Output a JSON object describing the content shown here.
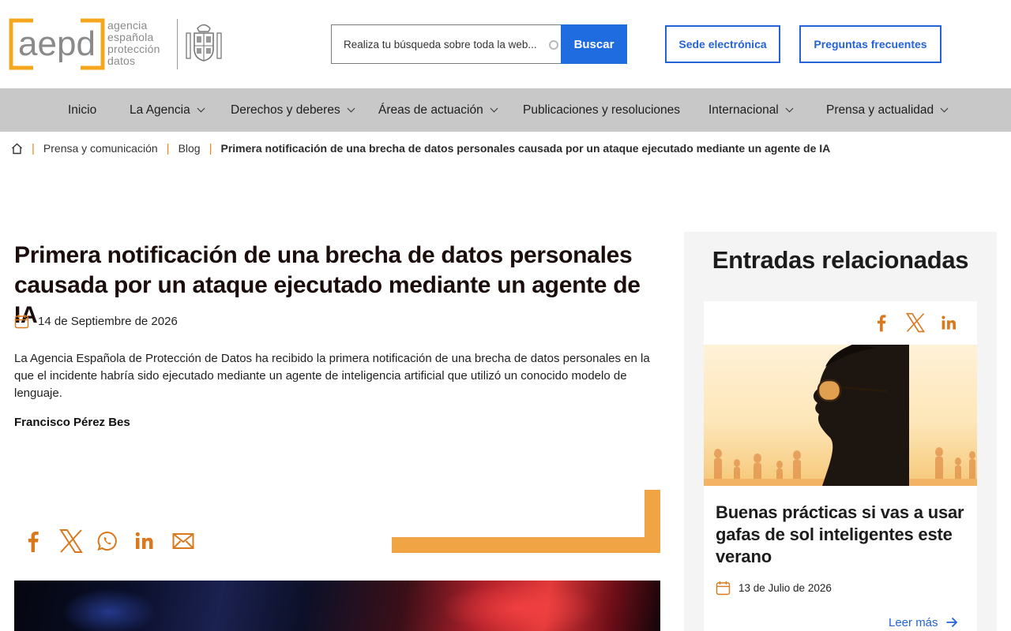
{
  "header": {
    "logo": {
      "mark": "aepd",
      "lines": [
        "agencia",
        "española",
        "protección",
        "datos"
      ],
      "shield_icon": "spanish-coat-of-arms-icon"
    },
    "search": {
      "placeholder": "Realiza tu búsqueda sobre toda la web...",
      "button_label": "Buscar"
    },
    "links": {
      "sede": "Sede electrónica",
      "faq": "Preguntas frecuentes"
    }
  },
  "nav": {
    "items": [
      {
        "label": "Inicio",
        "has_dropdown": false
      },
      {
        "label": "La Agencia",
        "has_dropdown": true
      },
      {
        "label": "Derechos y deberes",
        "has_dropdown": true
      },
      {
        "label": "Áreas de actuación",
        "has_dropdown": true
      },
      {
        "label": "Publicaciones y resoluciones",
        "has_dropdown": false
      },
      {
        "label": "Internacional",
        "has_dropdown": true
      },
      {
        "label": "Prensa y actualidad",
        "has_dropdown": true
      }
    ]
  },
  "breadcrumb": {
    "home_icon": "home-icon",
    "items": [
      "Prensa y comunicación",
      "Blog"
    ],
    "current": "Primera notificación de una brecha de datos personales causada por un ataque ejecutado mediante un agente de IA"
  },
  "article": {
    "title": "Primera notificación de una brecha de datos personales causada por un ataque ejecutado mediante un agente de IA",
    "date": "14 de Septiembre de 2026",
    "lead": "La Agencia Española de Protección de Datos ha recibido la primera notificación de una brecha de datos personales en la que el incidente habría sido ejecutado mediante un agente de inteligencia artificial que utilizó un conocido modelo de lenguaje.",
    "author": "Francisco Pérez Bes",
    "share_icons": [
      "facebook-icon",
      "x-icon",
      "whatsapp-icon",
      "linkedin-icon",
      "email-icon"
    ]
  },
  "sidebar": {
    "title": "Entradas relacionadas",
    "card": {
      "share_icons": [
        "facebook-icon",
        "x-icon",
        "linkedin-icon"
      ],
      "title": "Buenas prácticas si vas a usar gafas de sol inteligentes este verano",
      "date": "13 de Julio de 2026",
      "read_more": "Leer más"
    }
  },
  "colors": {
    "accent_orange": "#f0a443",
    "icon_orange": "#d9781c",
    "link_blue": "#2463d6",
    "button_blue": "#1f6be0",
    "nav_gray": "#c8c8c8",
    "logo_gray": "#8a8a8a",
    "logo_orange": "#f5a81e"
  }
}
